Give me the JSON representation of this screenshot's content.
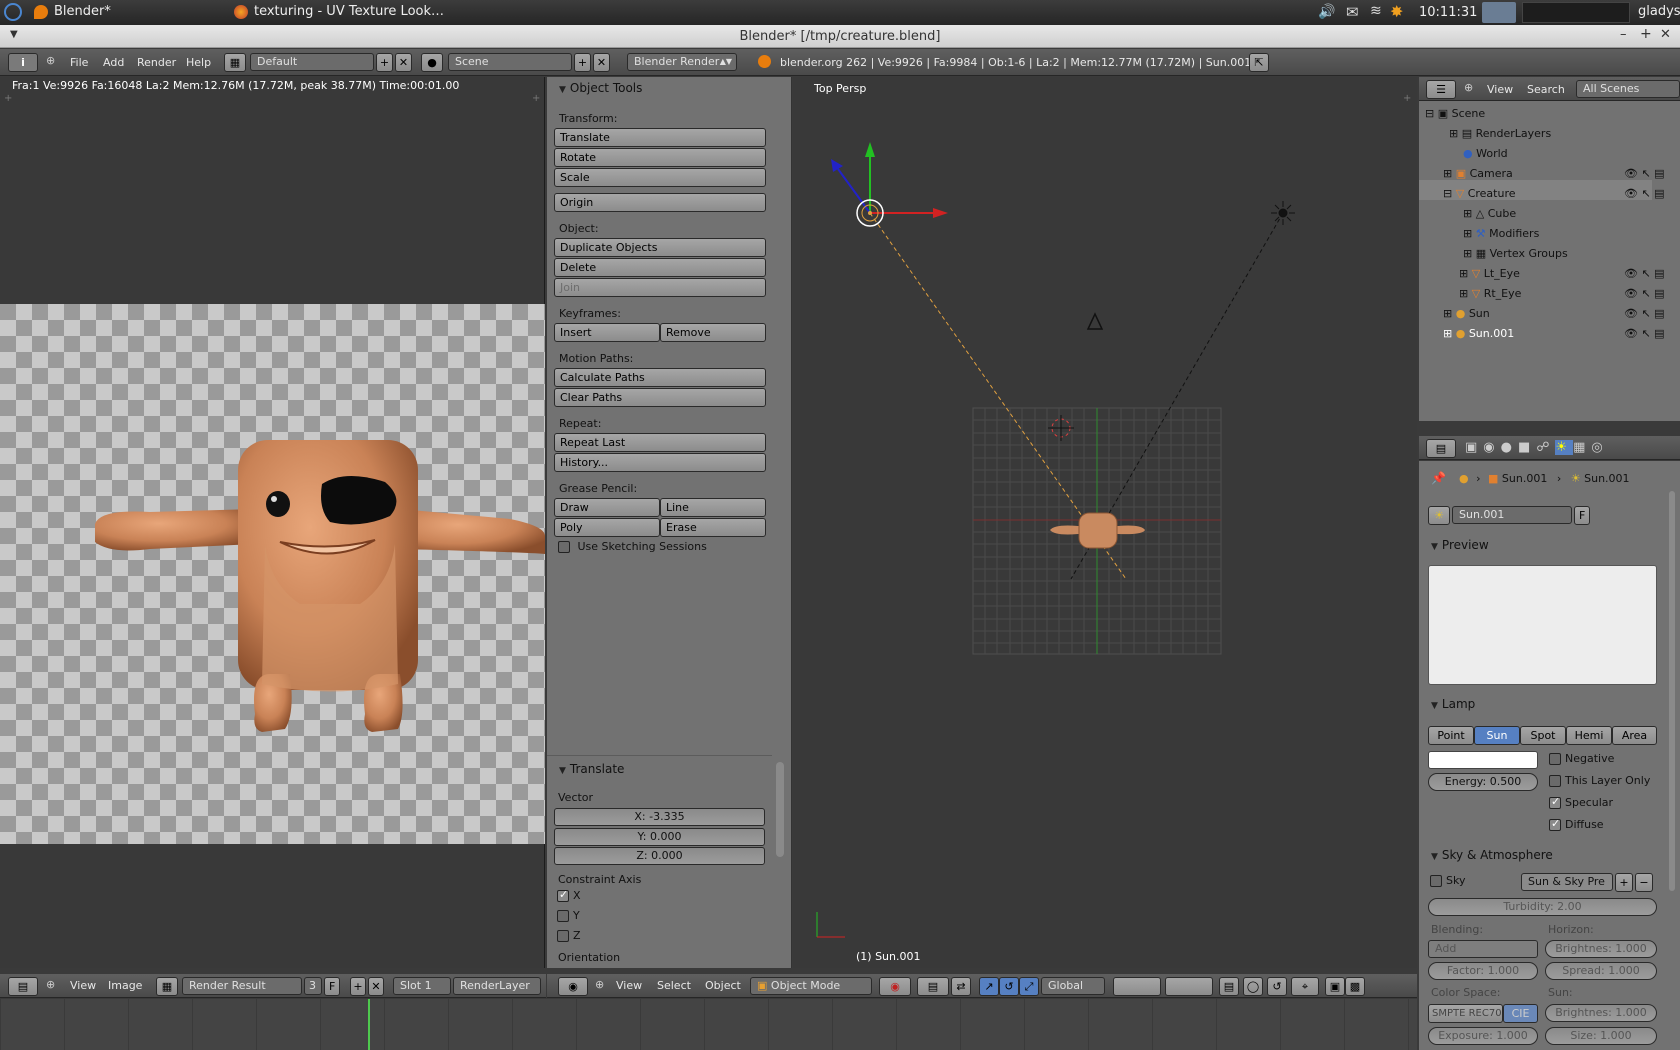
{
  "taskbar": {
    "items": [
      "Blender* [/tmp/creature.bl…",
      "texturing - UV Texture Look…"
    ],
    "clock": "10:11:31",
    "user": "gladys"
  },
  "window_title": "Blender* [/tmp/creature.blend]",
  "info_header": {
    "menus": [
      "File",
      "Add",
      "Render",
      "Help"
    ],
    "screen": "Default",
    "scene": "Scene",
    "engine": "Blender Render",
    "stats": "blender.org 262 | Ve:9926 | Fa:9984 | Ob:1-6 | La:2 | Mem:12.77M (17.72M) | Sun.001"
  },
  "image_editor": {
    "render_stats": "Fra:1  Ve:9926 Fa:16048 La:2 Mem:12.76M (17.72M, peak 38.77M) Time:00:01.00",
    "footer": {
      "view": "View",
      "image": "Image",
      "image_name": "Render Result",
      "users": "3",
      "fake": "F",
      "slot": "Slot 1",
      "layer": "RenderLayer"
    }
  },
  "tools": {
    "title": "Object Tools",
    "transform_label": "Transform:",
    "translate": "Translate",
    "rotate": "Rotate",
    "scale": "Scale",
    "origin": "Origin",
    "object_label": "Object:",
    "duplicate": "Duplicate Objects",
    "delete": "Delete",
    "join": "Join",
    "keyframes_label": "Keyframes:",
    "insert": "Insert",
    "remove": "Remove",
    "motion_label": "Motion Paths:",
    "calc_paths": "Calculate Paths",
    "clear_paths": "Clear Paths",
    "repeat_label": "Repeat:",
    "repeat_last": "Repeat Last",
    "history": "History...",
    "grease_label": "Grease Pencil:",
    "draw": "Draw",
    "line": "Line",
    "poly": "Poly",
    "erase": "Erase",
    "sketching": "Use Sketching Sessions"
  },
  "operator": {
    "title": "Translate",
    "vector_label": "Vector",
    "x": "X: -3.335",
    "y": "Y: 0.000",
    "z": "Z: 0.000",
    "constraint_label": "Constraint Axis",
    "axes": [
      "X",
      "Y",
      "Z"
    ],
    "orientation_label": "Orientation"
  },
  "viewport": {
    "label": "Top Persp",
    "object": "(1) Sun.001",
    "footer": {
      "view": "View",
      "select": "Select",
      "object": "Object",
      "mode": "Object Mode",
      "orientation": "Global"
    }
  },
  "outliner": {
    "view": "View",
    "search": "Search",
    "filter": "All Scenes",
    "items": [
      "Scene",
      "RenderLayers",
      "World",
      "Camera",
      "Creature",
      "Cube",
      "Modifiers",
      "Vertex Groups",
      "Lt_Eye",
      "Rt_Eye",
      "Sun",
      "Sun.001"
    ]
  },
  "properties": {
    "breadcrumb": [
      "Sun.001",
      "Sun.001"
    ],
    "datablock": "Sun.001",
    "fake": "F",
    "preview_title": "Preview",
    "lamp_title": "Lamp",
    "lamp_types": [
      "Point",
      "Sun",
      "Spot",
      "Hemi",
      "Area"
    ],
    "active_type": "Sun",
    "negative": "Negative",
    "this_layer": "This Layer Only",
    "specular": "Specular",
    "diffuse": "Diffuse",
    "energy": "Energy: 0.500",
    "sky_title": "Sky & Atmosphere",
    "sky": "Sky",
    "preset": "Sun & Sky Pre",
    "turbidity": "Turbidity: 2.00",
    "blending_label": "Blending:",
    "horizon_label": "Horizon:",
    "blend_mode": "Add",
    "h_bright": "Brightnes: 1.000",
    "factor": "Factor: 1.000",
    "spread": "Spread: 1.000",
    "colorspace_label": "Color Space:",
    "sun_label": "Sun:",
    "cs_value": "SMPTE REC70",
    "cie": "CIE",
    "s_bright": "Brightnes: 1.000",
    "exposure": "Exposure: 1.000",
    "size": "Size: 1.000"
  },
  "colors": {
    "accent": "#5680c2",
    "x_axis": "#d22222",
    "y_axis": "#22c022",
    "z_axis": "#2222c8"
  }
}
